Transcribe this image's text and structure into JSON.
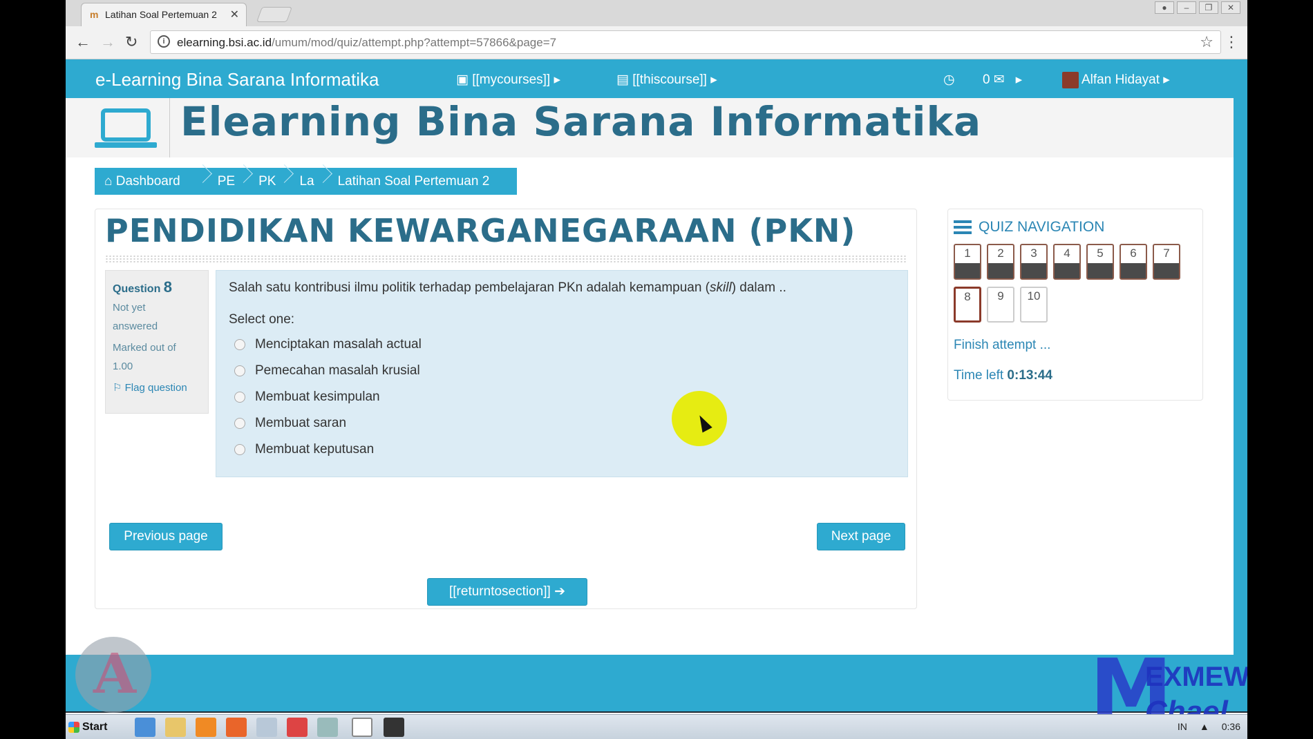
{
  "browser": {
    "tab_title": "Latihan Soal Pertemuan 2",
    "url_host": "elearning.bsi.ac.id",
    "url_path": "/umum/mod/quiz/attempt.php?attempt=57866&page=7"
  },
  "navbar": {
    "brand": "e-Learning Bina Sarana Informatika",
    "mycourses": "[[mycourses]]",
    "thiscourse": "[[thiscourse]]",
    "messages_count": "0",
    "user_name": "Alfan Hidayat"
  },
  "banner": {
    "title": "Elearning Bina Sarana Informatika"
  },
  "breadcrumb": [
    "Dashboard",
    "PE",
    "PK",
    "La",
    "Latihan Soal Pertemuan 2"
  ],
  "course": {
    "title": "PENDIDIKAN KEWARGANEGARAAN (PKN)"
  },
  "question": {
    "label": "Question",
    "number": "8",
    "status_line1": "Not yet",
    "status_line2": "answered",
    "marked_line1": "Marked out of",
    "marked_line2": "1.00",
    "flag": "Flag question",
    "text_before": "Salah satu kontribusi ilmu politik terhadap pembelajaran PKn adalah kemampuan (",
    "text_italic": "skill",
    "text_after": ") dalam ..",
    "select_one": "Select one:",
    "options": [
      "Menciptakan masalah actual",
      "Pemecahan masalah krusial",
      "Membuat kesimpulan",
      "Membuat saran",
      "Membuat keputusan"
    ]
  },
  "buttons": {
    "previous": "Previous page",
    "next": "Next page",
    "return": "[[returntosection]]"
  },
  "quiz_nav": {
    "heading": "QUIZ NAVIGATION",
    "numbers": [
      "1",
      "2",
      "3",
      "4",
      "5",
      "6",
      "7",
      "8",
      "9",
      "10"
    ],
    "finish": "Finish attempt ...",
    "time_label": "Time left",
    "time_value": "0:13:44"
  },
  "taskbar": {
    "start": "Start",
    "lang": "IN",
    "clock": "0:36"
  },
  "watermark": {
    "line1": "EXMEW",
    "line2": "Chael"
  },
  "colors": {
    "accent": "#2eaad0",
    "title": "#2b6d8a",
    "question_bg": "#dcecf5"
  }
}
